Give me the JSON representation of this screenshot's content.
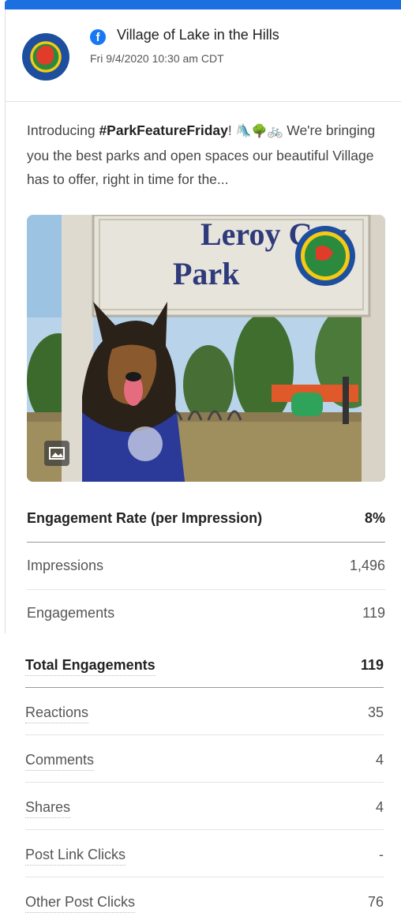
{
  "post": {
    "page_name": "Village of Lake in the Hills",
    "date": "Fri 9/4/2020 10:30 am CDT",
    "caption_intro": "Introducing ",
    "hashtag": "#ParkFeatureFriday",
    "caption_rest": "! ",
    "emojis": "🛝🌳🚲",
    "caption_body": " We're bringing you the best parks and open spaces our beautiful Village has to offer, right in time for the...",
    "photo_sign_line1": "Leroy Guy",
    "photo_sign_line2": "Park"
  },
  "metrics_top": [
    {
      "label": "Engagement Rate (per Impression)",
      "value": "8%"
    },
    {
      "label": "Impressions",
      "value": "1,496"
    },
    {
      "label": "Engagements",
      "value": "119"
    }
  ],
  "metrics_bottom": [
    {
      "label": "Total Engagements",
      "value": "119"
    },
    {
      "label": "Reactions",
      "value": "35"
    },
    {
      "label": "Comments",
      "value": "4"
    },
    {
      "label": "Shares",
      "value": "4"
    },
    {
      "label": "Post Link Clicks",
      "value": "-"
    },
    {
      "label": "Other Post Clicks",
      "value": "76"
    }
  ],
  "colors": {
    "accent": "#1c6fe0",
    "facebook": "#1877f2"
  },
  "icons": {
    "network": "facebook-icon",
    "media": "image-icon"
  }
}
